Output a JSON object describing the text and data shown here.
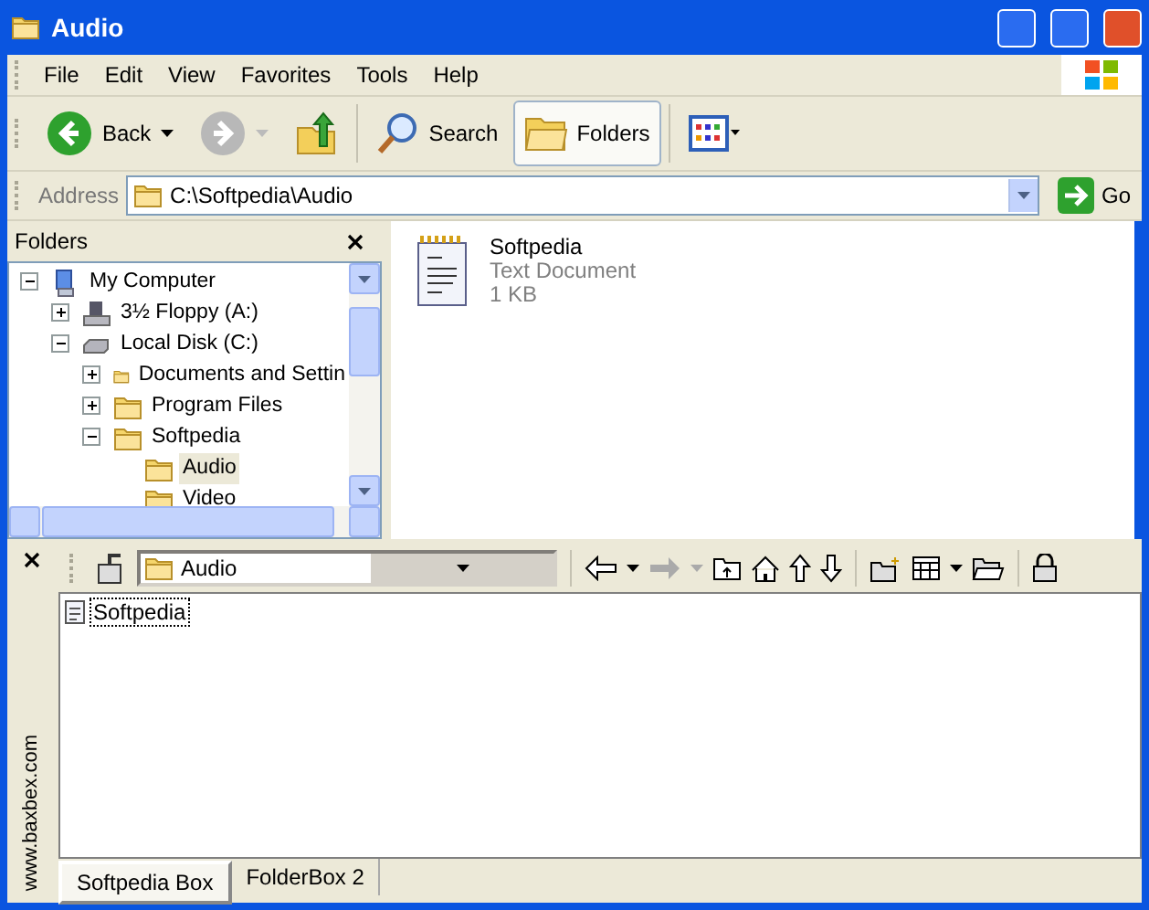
{
  "window": {
    "title": "Audio"
  },
  "menu": [
    "File",
    "Edit",
    "View",
    "Favorites",
    "Tools",
    "Help"
  ],
  "toolbar": [
    {
      "kind": "back",
      "label": "Back",
      "disabled": false
    },
    {
      "kind": "forward",
      "disabled": true
    },
    {
      "kind": "up"
    },
    {
      "kind": "search",
      "label": "Search",
      "selected": false
    },
    {
      "kind": "folders",
      "label": "Folders",
      "selected": true
    },
    {
      "kind": "views"
    }
  ],
  "address": {
    "label": "Address",
    "value": "C:\\Softpedia\\Audio",
    "go": "Go"
  },
  "folders_pane": {
    "title": "Folders",
    "tree": [
      {
        "label": "My Computer",
        "kind": "computer",
        "expanded": true,
        "selected": false,
        "children": [
          {
            "label": "3½ Floppy (A:)",
            "kind": "floppy",
            "expanded": false,
            "selected": false
          },
          {
            "label": "Local Disk (C:)",
            "kind": "disk",
            "expanded": true,
            "selected": false,
            "children": [
              {
                "label": "Documents and Settin",
                "kind": "folder",
                "expanded": false,
                "selected": false
              },
              {
                "label": "Program Files",
                "kind": "folder",
                "expanded": false,
                "selected": false
              },
              {
                "label": "Softpedia",
                "kind": "folder",
                "expanded": true,
                "selected": false,
                "children": [
                  {
                    "label": "Audio",
                    "kind": "folder",
                    "selected": true
                  },
                  {
                    "label": "Video",
                    "kind": "folder",
                    "selected": false
                  }
                ]
              }
            ]
          }
        ]
      }
    ]
  },
  "files": [
    {
      "name": "Softpedia",
      "type": "Text Document",
      "size": "1 KB"
    }
  ],
  "bottom_pane": {
    "side_text": "www.baxbex.com",
    "path": "Audio",
    "items": [
      {
        "name": "Softpedia",
        "selected": true
      }
    ],
    "tabs": [
      {
        "label": "Softpedia Box",
        "selected": true
      },
      {
        "label": "FolderBox 2",
        "selected": false
      }
    ]
  }
}
